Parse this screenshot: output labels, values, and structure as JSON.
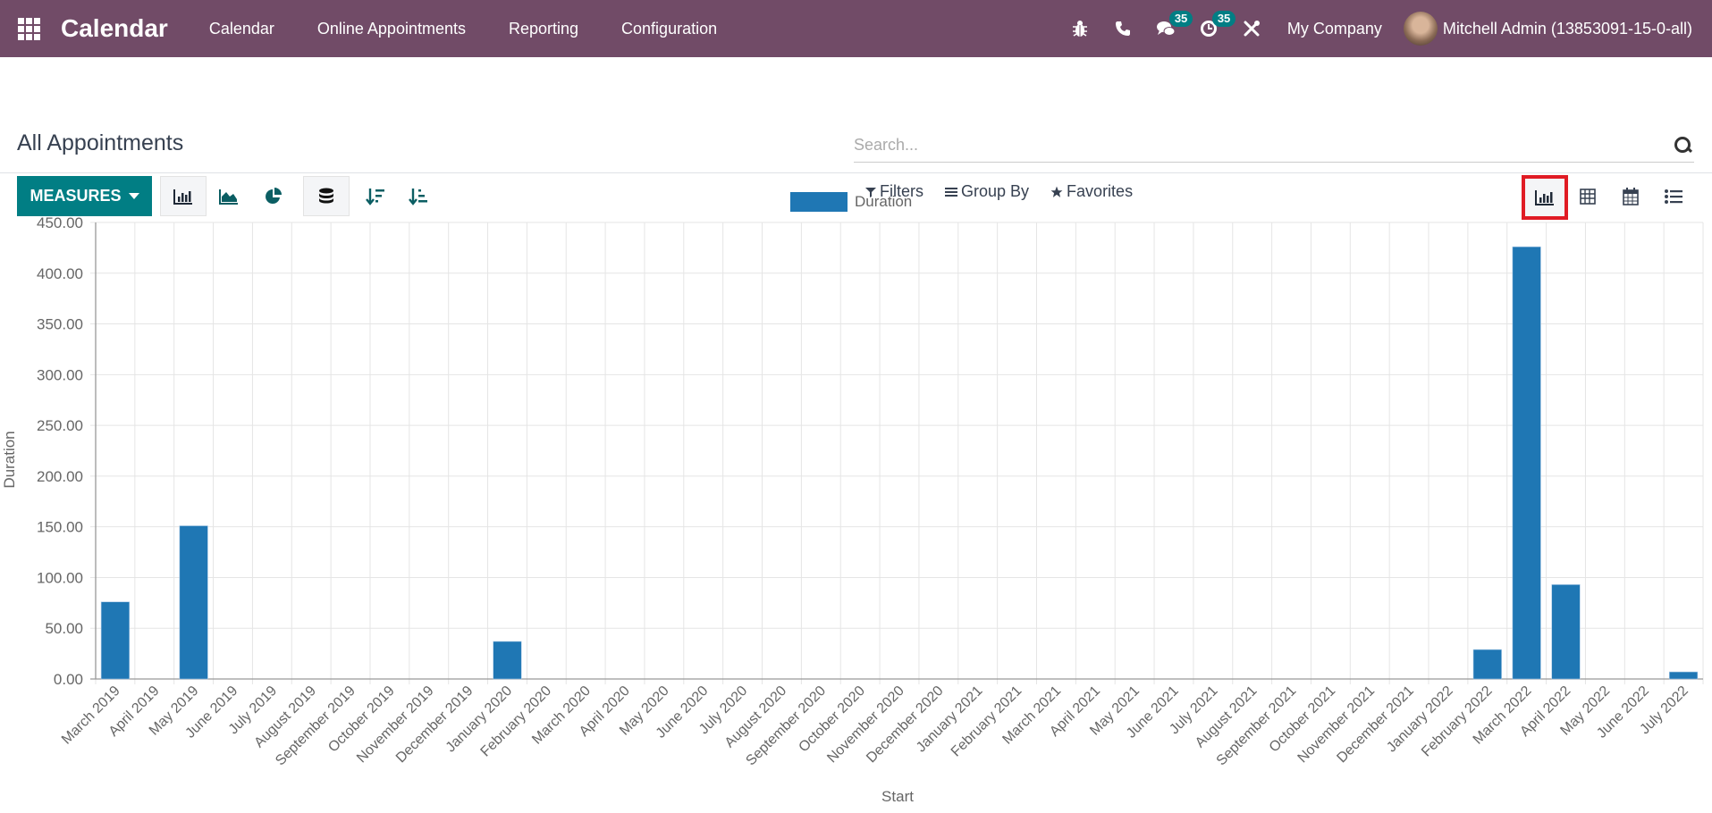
{
  "navbar": {
    "app_name": "Calendar",
    "menu": [
      "Calendar",
      "Online Appointments",
      "Reporting",
      "Configuration"
    ],
    "messages_badge": "35",
    "activities_badge": "35",
    "company": "My Company",
    "user": "Mitchell Admin (13853091-15-0-all)"
  },
  "control_panel": {
    "breadcrumb": "All Appointments",
    "search_placeholder": "Search...",
    "measures_label": "MEASURES",
    "filters_label": "Filters",
    "group_by_label": "Group By",
    "favorites_label": "Favorites",
    "active_chart_type": "bar",
    "active_view": "graph"
  },
  "colors": {
    "navbar": "#714B67",
    "primary": "#017e84",
    "bar": "#1f77b4",
    "highlight": "#e01b24"
  },
  "chart_data": {
    "type": "bar",
    "title": "",
    "xlabel": "Start",
    "ylabel": "Duration",
    "ylim": [
      0,
      450
    ],
    "yticks": [
      "0.00",
      "50.00",
      "100.00",
      "150.00",
      "200.00",
      "250.00",
      "300.00",
      "350.00",
      "400.00",
      "450.00"
    ],
    "legend": {
      "position": "top-center",
      "entries": [
        "Duration"
      ]
    },
    "grid": true,
    "categories": [
      "March 2019",
      "April 2019",
      "May 2019",
      "June 2019",
      "July 2019",
      "August 2019",
      "September 2019",
      "October 2019",
      "November 2019",
      "December 2019",
      "January 2020",
      "February 2020",
      "March 2020",
      "April 2020",
      "May 2020",
      "June 2020",
      "July 2020",
      "August 2020",
      "September 2020",
      "October 2020",
      "November 2020",
      "December 2020",
      "January 2021",
      "February 2021",
      "March 2021",
      "April 2021",
      "May 2021",
      "June 2021",
      "July 2021",
      "August 2021",
      "September 2021",
      "October 2021",
      "November 2021",
      "December 2021",
      "January 2022",
      "February 2022",
      "March 2022",
      "April 2022",
      "May 2022",
      "June 2022",
      "July 2022"
    ],
    "series": [
      {
        "name": "Duration",
        "values": [
          76,
          0,
          151,
          0,
          0,
          0,
          0,
          0,
          0,
          0,
          37,
          0,
          0,
          0,
          0,
          0,
          0,
          0,
          0,
          0,
          0,
          0,
          0,
          0,
          0,
          0,
          0,
          0,
          0,
          0,
          0,
          0,
          0,
          0,
          0,
          29,
          426,
          93,
          0,
          0,
          7
        ]
      }
    ]
  }
}
